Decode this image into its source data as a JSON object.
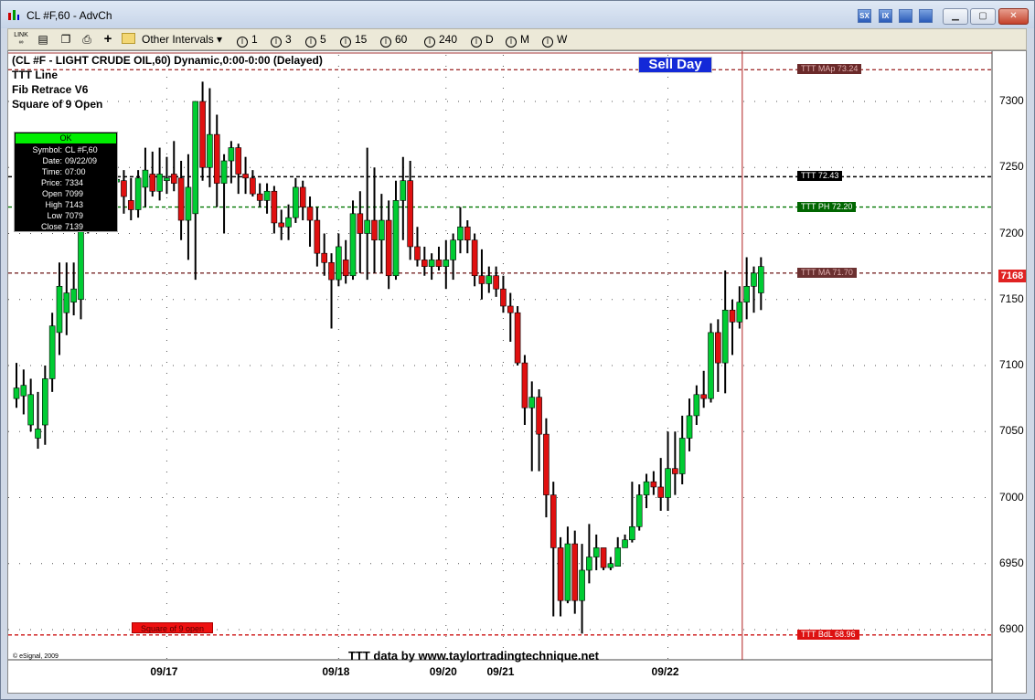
{
  "window": {
    "title": "CL #F,60 - AdvCh",
    "title_buttons": [
      "SX",
      "IX",
      "",
      ""
    ]
  },
  "toolbar": {
    "icons": [
      "link-icon",
      "chart-icon",
      "copy-icon",
      "print-icon",
      "plus-icon"
    ],
    "link_label": "LINK",
    "other_intervals_label": "Other Intervals ▾",
    "intervals": [
      "1",
      "3",
      "5",
      "15",
      "60",
      "240",
      "D",
      "M",
      "W"
    ]
  },
  "chart_header": {
    "symbol_line": "(CL #F - LIGHT CRUDE OIL,60) Dynamic,0:00-0:00 (Delayed)",
    "indicators": [
      "TTT Line",
      "Fib Retrace V6",
      "Square of 9 Open"
    ],
    "sell_day": "Sell Day",
    "footer": "TTT data by www.taylortradingtechnique.net",
    "copyright": "© eSignal, 2009"
  },
  "data_window": {
    "status": "OK",
    "rows": [
      {
        "label": "Symbol:",
        "value": "CL #F,60"
      },
      {
        "label": "Date:",
        "value": "09/22/09"
      },
      {
        "label": "Time:",
        "value": "07:00"
      },
      {
        "label": "Price:",
        "value": "7334"
      },
      {
        "label": "Open",
        "value": "7099"
      },
      {
        "label": "High",
        "value": "7143"
      },
      {
        "label": "Low",
        "value": "7079"
      },
      {
        "label": "Close",
        "value": "7139"
      }
    ]
  },
  "colors": {
    "up": "#00cc33",
    "down": "#e01010",
    "grid": "#555555"
  },
  "chart_data": {
    "type": "candlestick",
    "ylim": [
      6880,
      7340
    ],
    "y_ticks": [
      6900,
      6950,
      7000,
      7050,
      7100,
      7150,
      7200,
      7250,
      7300
    ],
    "x_tick_labels": [
      {
        "label": "09/17",
        "bar": 21
      },
      {
        "label": "09/18",
        "bar": 45
      },
      {
        "label": "09/20",
        "bar": 60
      },
      {
        "label": "09/21",
        "bar": 68
      },
      {
        "label": "09/22",
        "bar": 91
      }
    ],
    "current_price": "7168",
    "levels": [
      {
        "label": "TTT MAp 73.24",
        "value": 7324,
        "color": "#a33333",
        "label_bg": "#6b2a2a",
        "style": "dashed"
      },
      {
        "label": "TTT 72.43",
        "value": 7243,
        "color": "#000000",
        "label_bg": "#000000",
        "style": "dashed"
      },
      {
        "label": "TTT PH 72.20",
        "value": 7220,
        "color": "#007700",
        "label_bg": "#006600",
        "style": "dashed"
      },
      {
        "label": "TTT MA 71.70",
        "value": 7170,
        "color": "#7a2a2a",
        "label_bg": "#6b3030",
        "style": "dashed"
      },
      {
        "label": "TTT BdL 68.96",
        "value": 6896,
        "color": "#cc1111",
        "label_bg": "#dd1111",
        "style": "dashed"
      }
    ],
    "square_of_9_label": "Square of 9 open",
    "square_of_9_value": 6896,
    "vertical_marker_bar": 101,
    "ohlc": [
      [
        7075,
        7102,
        7068,
        7083
      ],
      [
        7077,
        7097,
        7063,
        7085
      ],
      [
        7055,
        7090,
        7050,
        7078
      ],
      [
        7045,
        7080,
        7037,
        7052
      ],
      [
        7055,
        7100,
        7040,
        7090
      ],
      [
        7090,
        7140,
        7080,
        7130
      ],
      [
        7125,
        7178,
        7108,
        7160
      ],
      [
        7140,
        7178,
        7123,
        7155
      ],
      [
        7148,
        7178,
        7138,
        7158
      ],
      [
        7150,
        7225,
        7135,
        7215
      ],
      [
        7210,
        7235,
        7200,
        7225
      ],
      [
        7225,
        7243,
        7218,
        7232
      ],
      [
        7232,
        7242,
        7226,
        7236
      ],
      [
        7235,
        7245,
        7228,
        7240
      ],
      [
        7239,
        7245,
        7232,
        7241
      ],
      [
        7240,
        7248,
        7215,
        7228
      ],
      [
        7225,
        7242,
        7210,
        7218
      ],
      [
        7218,
        7248,
        7212,
        7242
      ],
      [
        7235,
        7265,
        7220,
        7248
      ],
      [
        7245,
        7262,
        7228,
        7232
      ],
      [
        7232,
        7265,
        7225,
        7245
      ],
      [
        7240,
        7258,
        7230,
        7242
      ],
      [
        7245,
        7270,
        7232,
        7238
      ],
      [
        7242,
        7255,
        7195,
        7210
      ],
      [
        7210,
        7260,
        7180,
        7235
      ],
      [
        7215,
        7290,
        7165,
        7300
      ],
      [
        7300,
        7315,
        7240,
        7250
      ],
      [
        7250,
        7310,
        7235,
        7275
      ],
      [
        7275,
        7290,
        7220,
        7238
      ],
      [
        7238,
        7260,
        7200,
        7255
      ],
      [
        7255,
        7270,
        7238,
        7265
      ],
      [
        7265,
        7268,
        7230,
        7245
      ],
      [
        7245,
        7258,
        7230,
        7242
      ],
      [
        7242,
        7248,
        7228,
        7230
      ],
      [
        7230,
        7238,
        7220,
        7225
      ],
      [
        7225,
        7238,
        7215,
        7232
      ],
      [
        7232,
        7236,
        7200,
        7208
      ],
      [
        7208,
        7218,
        7195,
        7205
      ],
      [
        7205,
        7222,
        7195,
        7212
      ],
      [
        7212,
        7242,
        7208,
        7235
      ],
      [
        7235,
        7240,
        7210,
        7220
      ],
      [
        7220,
        7228,
        7190,
        7210
      ],
      [
        7210,
        7220,
        7175,
        7185
      ],
      [
        7185,
        7200,
        7168,
        7178
      ],
      [
        7178,
        7185,
        7128,
        7165
      ],
      [
        7165,
        7200,
        7160,
        7190
      ],
      [
        7180,
        7195,
        7162,
        7168
      ],
      [
        7168,
        7225,
        7165,
        7215
      ],
      [
        7215,
        7232,
        7170,
        7200
      ],
      [
        7200,
        7265,
        7165,
        7210
      ],
      [
        7210,
        7250,
        7170,
        7195
      ],
      [
        7195,
        7230,
        7170,
        7210
      ],
      [
        7210,
        7225,
        7158,
        7168
      ],
      [
        7168,
        7240,
        7165,
        7225
      ],
      [
        7225,
        7258,
        7195,
        7240
      ],
      [
        7240,
        7255,
        7180,
        7190
      ],
      [
        7190,
        7205,
        7175,
        7180
      ],
      [
        7180,
        7190,
        7168,
        7175
      ],
      [
        7175,
        7185,
        7165,
        7180
      ],
      [
        7180,
        7190,
        7172,
        7175
      ],
      [
        7175,
        7195,
        7158,
        7180
      ],
      [
        7180,
        7200,
        7165,
        7195
      ],
      [
        7195,
        7220,
        7185,
        7205
      ],
      [
        7205,
        7210,
        7185,
        7195
      ],
      [
        7195,
        7200,
        7160,
        7168
      ],
      [
        7168,
        7188,
        7150,
        7162
      ],
      [
        7162,
        7175,
        7155,
        7168
      ],
      [
        7168,
        7175,
        7152,
        7158
      ],
      [
        7158,
        7168,
        7140,
        7145
      ],
      [
        7145,
        7155,
        7118,
        7140
      ],
      [
        7140,
        7145,
        7100,
        7102
      ],
      [
        7102,
        7108,
        7055,
        7068
      ],
      [
        7068,
        7088,
        7020,
        7076
      ],
      [
        7076,
        7082,
        7020,
        7048
      ],
      [
        7048,
        7060,
        6985,
        7002
      ],
      [
        7002,
        7012,
        6910,
        6962
      ],
      [
        6962,
        6970,
        6910,
        6922
      ],
      [
        6922,
        6978,
        6920,
        6965
      ],
      [
        6965,
        6975,
        6912,
        6922
      ],
      [
        6922,
        6965,
        6897,
        6945
      ],
      [
        6945,
        6980,
        6935,
        6955
      ],
      [
        6955,
        6972,
        6945,
        6962
      ],
      [
        6962,
        6962,
        6945,
        6947
      ],
      [
        6947,
        6955,
        6945,
        6950
      ],
      [
        6948,
        6970,
        6948,
        6962
      ],
      [
        6962,
        6972,
        6962,
        6968
      ],
      [
        6968,
        7012,
        6966,
        6978
      ],
      [
        6978,
        7010,
        6975,
        7002
      ],
      [
        7002,
        7018,
        6992,
        7012
      ],
      [
        7012,
        7020,
        7002,
        7008
      ],
      [
        7008,
        7030,
        6990,
        7000
      ],
      [
        7000,
        7050,
        6990,
        7022
      ],
      [
        7022,
        7050,
        7002,
        7018
      ],
      [
        7018,
        7062,
        7010,
        7045
      ],
      [
        7045,
        7075,
        7035,
        7062
      ],
      [
        7062,
        7085,
        7055,
        7078
      ],
      [
        7078,
        7096,
        7068,
        7075
      ],
      [
        7075,
        7132,
        7072,
        7125
      ],
      [
        7125,
        7135,
        7080,
        7102
      ],
      [
        7102,
        7172,
        7079,
        7142
      ],
      [
        7142,
        7150,
        7108,
        7133
      ],
      [
        7133,
        7160,
        7128,
        7148
      ],
      [
        7148,
        7182,
        7135,
        7160
      ],
      [
        7160,
        7175,
        7140,
        7170
      ],
      [
        7155,
        7182,
        7142,
        7175
      ]
    ]
  }
}
